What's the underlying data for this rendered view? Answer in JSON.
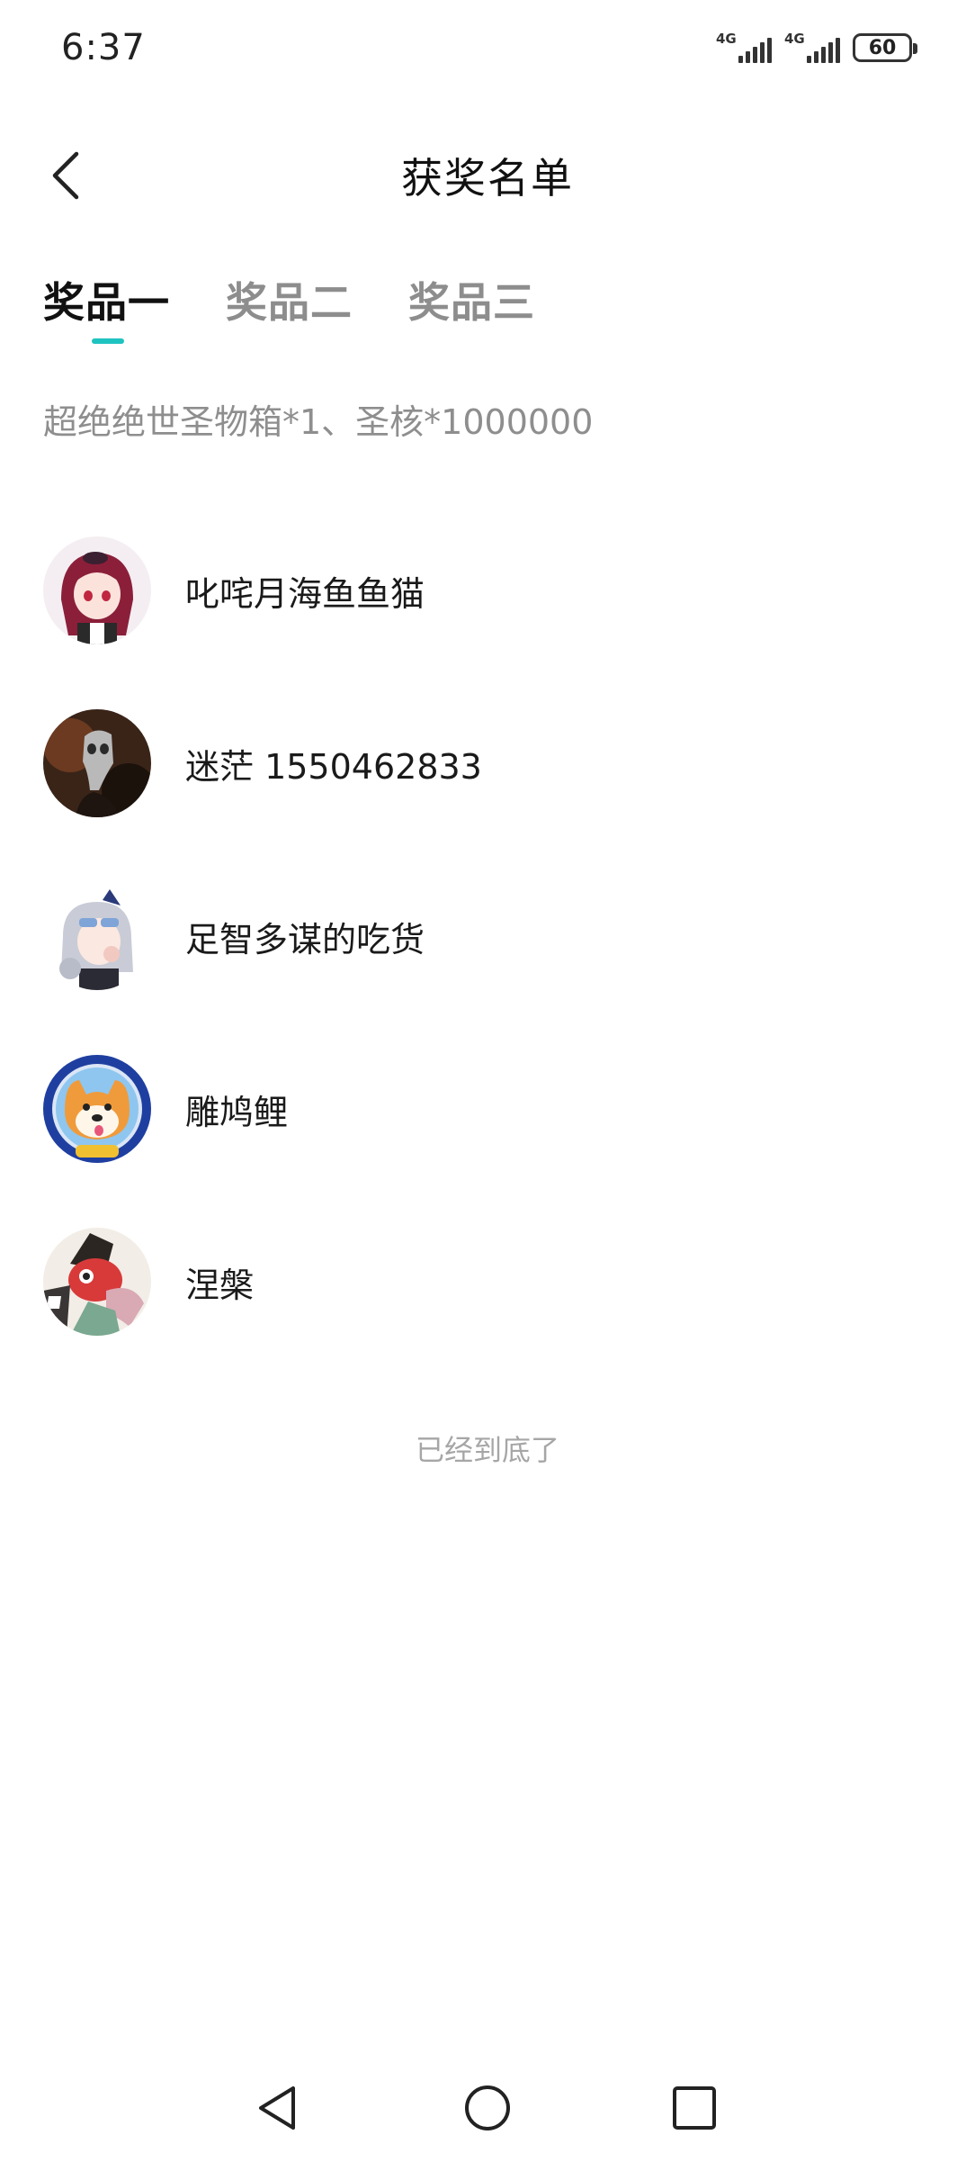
{
  "status_bar": {
    "time": "6:37",
    "network_1": "4G",
    "network_2": "4G",
    "battery": "60"
  },
  "header": {
    "title": "获奖名单"
  },
  "tabs": [
    {
      "label": "奖品一",
      "active": true
    },
    {
      "label": "奖品二",
      "active": false
    },
    {
      "label": "奖品三",
      "active": false
    }
  ],
  "prize_description": "超绝绝世圣物箱*1、圣核*1000000",
  "winners": [
    {
      "name": "叱咤月海鱼鱼猫"
    },
    {
      "name": "迷茫 1550462833"
    },
    {
      "name": "足智多谋的吃货"
    },
    {
      "name": "雕鸠鲤"
    },
    {
      "name": "涅槃"
    }
  ],
  "end_text": "已经到底了",
  "colors": {
    "accent": "#1fc3c0",
    "tab_inactive": "#8d8d8d",
    "secondary_text": "#8e8e8e"
  },
  "icons": {
    "back": "chevron-left-icon",
    "nav_back": "triangle-back-icon",
    "nav_home": "circle-home-icon",
    "nav_recent": "square-recent-icon"
  }
}
